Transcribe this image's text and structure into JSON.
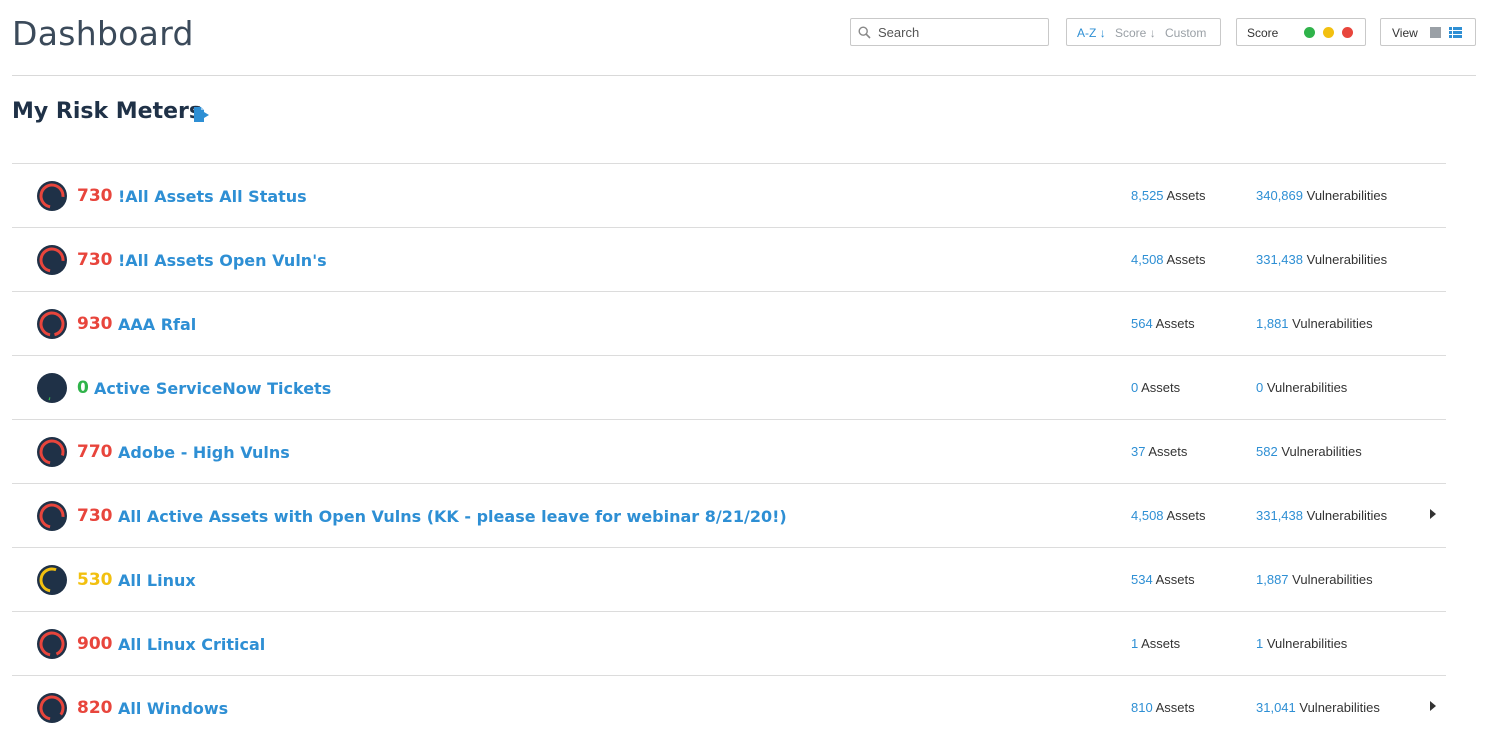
{
  "header": {
    "title": "Dashboard",
    "search": {
      "placeholder": "Search",
      "value": ""
    },
    "sort": {
      "az": "A-Z",
      "score": "Score",
      "custom": "Custom"
    },
    "score_filter": {
      "label": "Score",
      "colors": [
        "#2fb34a",
        "#f2c010",
        "#e8453c"
      ]
    },
    "view": {
      "label": "View"
    }
  },
  "section": {
    "title": "My Risk Meters"
  },
  "colors": {
    "red": "#e8453c",
    "yellow": "#f2c010",
    "green": "#2fb34a",
    "link": "#2e8fd4",
    "gauge_bg": "#1f3147"
  },
  "meters": [
    {
      "score": "730",
      "name": "!All Assets All Status",
      "assets": "8,525",
      "assets_label": "Assets",
      "vulns": "340,869",
      "vulns_label": "Vulnerabilities",
      "level": "red",
      "fill": 0.73,
      "expand": false
    },
    {
      "score": "730",
      "name": "!All Assets Open Vuln's",
      "assets": "4,508",
      "assets_label": "Assets",
      "vulns": "331,438",
      "vulns_label": "Vulnerabilities",
      "level": "red",
      "fill": 0.73,
      "expand": false
    },
    {
      "score": "930",
      "name": "AAA Rfal",
      "assets": "564",
      "assets_label": "Assets",
      "vulns": "1,881",
      "vulns_label": "Vulnerabilities",
      "level": "red",
      "fill": 0.93,
      "expand": false
    },
    {
      "score": "0",
      "name": "Active ServiceNow Tickets",
      "assets": "0",
      "assets_label": "Assets",
      "vulns": "0",
      "vulns_label": "Vulnerabilities",
      "level": "green",
      "fill": 0.0,
      "expand": false
    },
    {
      "score": "770",
      "name": "Adobe - High Vulns",
      "assets": "37",
      "assets_label": "Assets",
      "vulns": "582",
      "vulns_label": "Vulnerabilities",
      "level": "red",
      "fill": 0.77,
      "expand": false
    },
    {
      "score": "730",
      "name": "All Active Assets with Open Vulns (KK - please leave for webinar 8/21/20!)",
      "assets": "4,508",
      "assets_label": "Assets",
      "vulns": "331,438",
      "vulns_label": "Vulnerabilities",
      "level": "red",
      "fill": 0.73,
      "expand": true
    },
    {
      "score": "530",
      "name": "All Linux",
      "assets": "534",
      "assets_label": "Assets",
      "vulns": "1,887",
      "vulns_label": "Vulnerabilities",
      "level": "yellow",
      "fill": 0.53,
      "expand": false
    },
    {
      "score": "900",
      "name": "All Linux Critical",
      "assets": "1",
      "assets_label": "Assets",
      "vulns": "1",
      "vulns_label": "Vulnerabilities",
      "level": "red",
      "fill": 0.9,
      "expand": false
    },
    {
      "score": "820",
      "name": "All Windows",
      "assets": "810",
      "assets_label": "Assets",
      "vulns": "31,041",
      "vulns_label": "Vulnerabilities",
      "level": "red",
      "fill": 0.82,
      "expand": true
    }
  ]
}
